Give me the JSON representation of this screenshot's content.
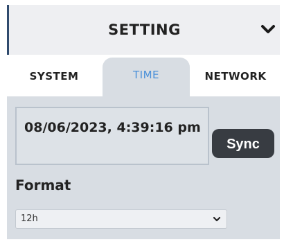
{
  "header": {
    "title": "SETTING",
    "collapse_icon": "chevron-down-icon"
  },
  "tabs": [
    {
      "label": "SYSTEM",
      "active": false
    },
    {
      "label": "TIME",
      "active": true
    },
    {
      "label": "NETWORK",
      "active": false
    }
  ],
  "time": {
    "datetime_value": "08/06/2023, 4:39:16 pm",
    "sync_label": "Sync",
    "format_label": "Format",
    "format_selected": "12h"
  },
  "colors": {
    "accent_border": "#2f4a6d",
    "active_tab_text": "#4a90d9",
    "panel_bg": "#d8dde3",
    "button_bg": "#383c42"
  }
}
